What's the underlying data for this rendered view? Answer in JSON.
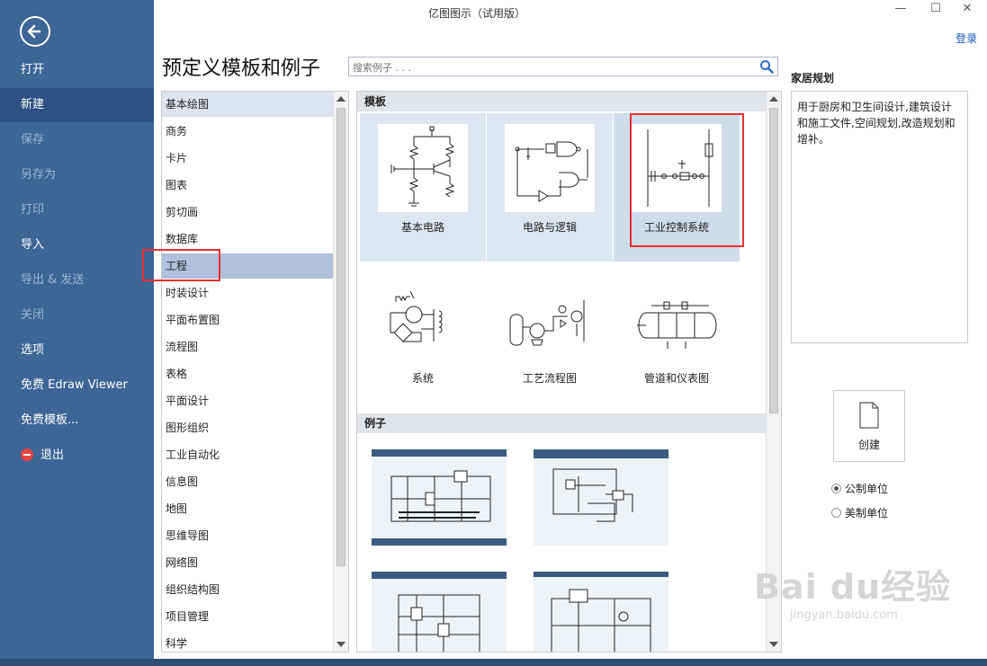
{
  "window": {
    "title": "亿图图示（试用版）",
    "login": "登录",
    "minimize": "—",
    "maximize": "☐",
    "close": "✕"
  },
  "sidebar": {
    "items": [
      {
        "label": "打开"
      },
      {
        "label": "新建"
      },
      {
        "label": "保存"
      },
      {
        "label": "另存为"
      },
      {
        "label": "打印"
      },
      {
        "label": "导入"
      },
      {
        "label": "导出 & 发送"
      },
      {
        "label": "关闭"
      },
      {
        "label": "选项"
      },
      {
        "label": "免费 Edraw Viewer"
      },
      {
        "label": "免费模板..."
      },
      {
        "label": "退出"
      }
    ]
  },
  "main": {
    "heading": "预定义模板和例子",
    "search_placeholder": "搜索例子 . . ."
  },
  "categories": [
    "基本绘图",
    "商务",
    "卡片",
    "图表",
    "剪切画",
    "数据库",
    "工程",
    "时装设计",
    "平面布置图",
    "流程图",
    "表格",
    "平面设计",
    "图形组织",
    "工业自动化",
    "信息图",
    "地图",
    "思维导图",
    "网络图",
    "组织结构图",
    "项目管理",
    "科学"
  ],
  "templates": {
    "section_label": "模板",
    "items": [
      {
        "label": "基本电路"
      },
      {
        "label": "电路与逻辑"
      },
      {
        "label": "工业控制系统"
      },
      {
        "label": "系统"
      },
      {
        "label": "工艺流程图"
      },
      {
        "label": "管道和仪表图"
      }
    ]
  },
  "examples": {
    "section_label": "例子"
  },
  "right_panel": {
    "title": "家居规划",
    "description": "用于厨房和卫生间设计,建筑设计和施工文件,空间规划,改造规划和增补。",
    "create_label": "创建",
    "units": [
      {
        "label": "公制单位",
        "checked": true
      },
      {
        "label": "美制单位",
        "checked": false
      }
    ]
  },
  "watermark": {
    "brand": "Bai du经验",
    "url": "jingyan.baidu.com"
  },
  "colors": {
    "sidebar": "#3d6596",
    "sidebar_active": "#2d5283",
    "selected_category": "#b0c0dd",
    "highlight": "#e53030",
    "link": "#1a56b8"
  }
}
